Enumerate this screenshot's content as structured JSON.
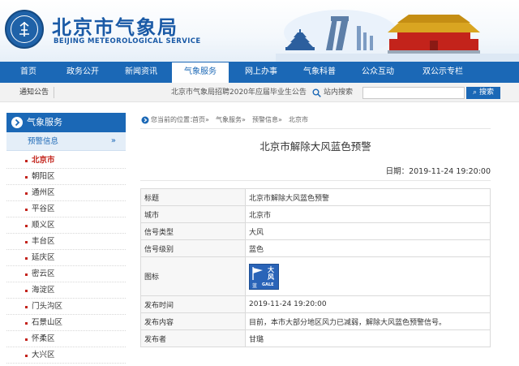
{
  "site": {
    "title": "北京市气象局",
    "subtitle": "BEIJING METEOROLOGICAL SERVICE"
  },
  "nav": {
    "items": [
      {
        "label": "首页"
      },
      {
        "label": "政务公开"
      },
      {
        "label": "新闻资讯"
      },
      {
        "label": "气象服务",
        "active": true
      },
      {
        "label": "网上办事"
      },
      {
        "label": "气象科普"
      },
      {
        "label": "公众互动"
      },
      {
        "label": "双公示专栏"
      }
    ]
  },
  "notice": {
    "label": "通知公告",
    "text": "北京市气象局招聘2020年应届毕业生公告"
  },
  "search": {
    "label": "站内搜索",
    "placeholder": "",
    "button": "搜索"
  },
  "sidebar": {
    "heading": "气象服务",
    "sub": "预警信息",
    "arrow": "»",
    "items": [
      {
        "label": "北京市",
        "active": true
      },
      {
        "label": "朝阳区"
      },
      {
        "label": "通州区"
      },
      {
        "label": "平谷区"
      },
      {
        "label": "顺义区"
      },
      {
        "label": "丰台区"
      },
      {
        "label": "延庆区"
      },
      {
        "label": "密云区"
      },
      {
        "label": "海淀区"
      },
      {
        "label": "门头沟区"
      },
      {
        "label": "石景山区"
      },
      {
        "label": "怀柔区"
      },
      {
        "label": "大兴区"
      }
    ]
  },
  "breadcrumb": {
    "prefix": "您当前的位置：",
    "items": [
      "首页",
      "气象服务",
      "预警信息",
      "北京市"
    ],
    "sep": " » "
  },
  "article": {
    "title": "北京市解除大风蓝色预警",
    "date_label": "日期：",
    "date": "2019-11-24 19:20:00"
  },
  "table": {
    "rows": [
      {
        "key": "标题",
        "value": "北京市解除大风蓝色预警"
      },
      {
        "key": "城市",
        "value": "北京市"
      },
      {
        "key": "信号类型",
        "value": "大风"
      },
      {
        "key": "信号级别",
        "value": "蓝色"
      },
      {
        "key": "图标",
        "value": ""
      },
      {
        "key": "发布时间",
        "value": "2019-11-24 19:20:00"
      },
      {
        "key": "发布内容",
        "value": "目前，本市大部分地区风力已减弱，解除大风蓝色预警信号。"
      },
      {
        "key": "发布者",
        "value": "甘璐"
      }
    ]
  },
  "warning_icon": {
    "char1": "大",
    "char2": "风",
    "level": "蓝",
    "en": "GALE",
    "color": "#2a64b8"
  }
}
